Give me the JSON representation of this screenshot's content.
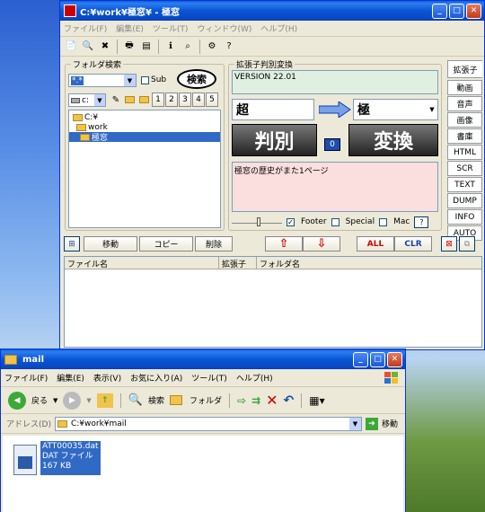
{
  "kiwa": {
    "title": "C:¥work¥極窓¥ - 極窓",
    "menus": [
      "ファイル(F)",
      "編集(E)",
      "ツール(T)",
      "ウィンドウ(W)",
      "ヘルプ(H)"
    ],
    "folder_search": {
      "title": "フォルダ検索",
      "pattern": "*.*",
      "sub_label": "Sub",
      "search_button": "検索",
      "drive": "c:",
      "num_tabs": [
        "1",
        "2",
        "3",
        "4",
        "5"
      ],
      "tree": [
        "C:¥",
        "work",
        "極窓"
      ]
    },
    "ext_judge": {
      "title": "拡張子判別変換",
      "version": "VERSION 22.01",
      "from_ext": "超",
      "to_ext": "極",
      "judge_button": "判別",
      "count": "0",
      "convert_button": "変換",
      "message": "極窓の歴史がまた1ページ",
      "footer_label": "Footer",
      "special_label": "Special",
      "mac_label": "Mac",
      "help_button": "?"
    },
    "side_tabs": [
      "拡張子",
      "動画",
      "音声",
      "画像",
      "書庫",
      "HTML",
      "SCR",
      "TEXT",
      "DUMP",
      "INFO",
      "AUTO"
    ],
    "actions": {
      "move": "移動",
      "copy": "コピー",
      "delete": "削除",
      "up": "⇧",
      "down": "⇩",
      "all": "ALL",
      "clr": "CLR"
    },
    "columns": [
      "ファイル名",
      "拡張子",
      "フォルダ名"
    ]
  },
  "explorer": {
    "title": "mail",
    "menus": [
      "ファイル(F)",
      "編集(E)",
      "表示(V)",
      "お気に入り(A)",
      "ツール(T)",
      "ヘルプ(H)"
    ],
    "toolbar": {
      "back": "戻る",
      "search": "検索",
      "folders": "フォルダ"
    },
    "address_label": "アドレス(D)",
    "address": "C:¥work¥mail",
    "go": "移動",
    "file": {
      "name": "ATT00035.dat",
      "type": "DAT ファイル",
      "size": "167 KB"
    }
  },
  "colors": {
    "title_blue": "#0a55d4",
    "window_bg": "#ece9d8",
    "message_bg": "#fbdede",
    "version_bg": "#e0f0e0",
    "red_text": "#d00000"
  }
}
